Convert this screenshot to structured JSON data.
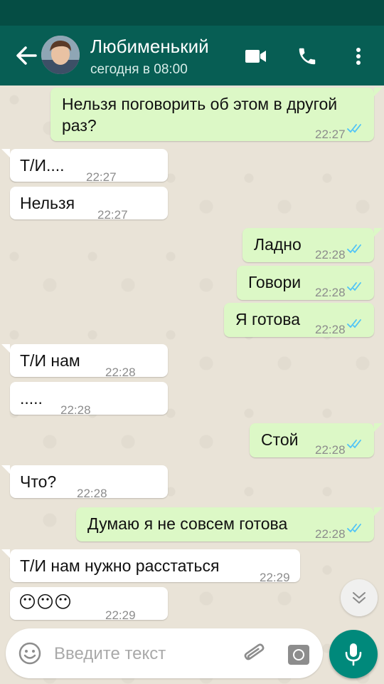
{
  "header": {
    "contact_name": "Любименький",
    "contact_status": "сегодня в 08:00",
    "back_icon": "arrow-left-icon",
    "video_icon": "videocam-icon",
    "call_icon": "phone-icon",
    "menu_icon": "more-vert-icon"
  },
  "messages": [
    {
      "dir": "out",
      "line1": "Нельзя поговорить об этом в другой",
      "line2": "раз?",
      "time": "22:27",
      "read": true
    },
    {
      "dir": "in",
      "text": "Т/И....",
      "time": "22:27"
    },
    {
      "dir": "in",
      "text": "Нельзя",
      "time": "22:27"
    },
    {
      "dir": "out",
      "text": "Ладно",
      "time": "22:28",
      "read": true
    },
    {
      "dir": "out",
      "text": "Говори",
      "time": "22:28",
      "read": true
    },
    {
      "dir": "out",
      "text": "Я готова",
      "time": "22:28",
      "read": true
    },
    {
      "dir": "in",
      "text": "Т/И нам",
      "time": "22:28"
    },
    {
      "dir": "in",
      "text": ".....",
      "time": "22:28"
    },
    {
      "dir": "out",
      "text": "Стой",
      "time": "22:28",
      "read": true
    },
    {
      "dir": "in",
      "text": "Что?",
      "time": "22:28"
    },
    {
      "dir": "out",
      "text": "Думаю я не совсем готова",
      "time": "22:28",
      "read": true
    },
    {
      "dir": "in",
      "text": "Т/И нам нужно расстаться",
      "time": "22:29"
    },
    {
      "dir": "in",
      "text": "😶😶😶",
      "time": "22:29"
    }
  ],
  "composer": {
    "placeholder": "Введите текст",
    "emoji_icon": "emoji-icon",
    "attach_icon": "paperclip-icon",
    "camera_icon": "camera-icon",
    "mic_icon": "microphone-icon"
  },
  "colors": {
    "header": "#075e54",
    "status_bar": "#054d44",
    "outgoing_bubble": "#dcf8c6",
    "incoming_bubble": "#ffffff",
    "read_ticks": "#4fc3f7",
    "mic_button": "#00897b"
  }
}
